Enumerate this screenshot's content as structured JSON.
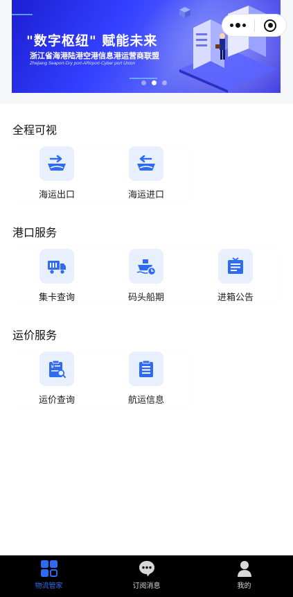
{
  "banner": {
    "title": "\"数字枢纽\"  赋能未来",
    "subtitle": "浙江省海港陆港空港信息港运营商联盟",
    "subtitle_en": "Zhejiang Seaport-Dry port-ARirport-Cyber port Union",
    "slides": 3,
    "active_slide": 1
  },
  "capsule": {
    "more_icon": "more-dots-icon",
    "close_icon": "close-target-icon"
  },
  "sections": [
    {
      "title": "全程可视",
      "items": [
        {
          "label": "海运出口",
          "icon": "ship-export-icon"
        },
        {
          "label": "海运进口",
          "icon": "ship-import-icon"
        }
      ]
    },
    {
      "title": "港口服务",
      "items": [
        {
          "label": "集卡查询",
          "icon": "truck-icon"
        },
        {
          "label": "码头船期",
          "icon": "ship-schedule-icon"
        },
        {
          "label": "进箱公告",
          "icon": "announcement-icon"
        }
      ]
    },
    {
      "title": "运价服务",
      "items": [
        {
          "label": "运价查询",
          "icon": "price-search-icon"
        },
        {
          "label": "航运信息",
          "icon": "shipping-info-icon"
        }
      ]
    }
  ],
  "tabbar": {
    "active": 0,
    "tabs": [
      {
        "label": "物流管家",
        "icon": "grid-home-icon"
      },
      {
        "label": "订阅消息",
        "icon": "chat-bubble-icon"
      },
      {
        "label": "我的",
        "icon": "user-icon"
      }
    ]
  },
  "colors": {
    "accent": "#2f6bf2",
    "icon_bg": "#e8effd",
    "banner_blue": "#3441ff"
  }
}
